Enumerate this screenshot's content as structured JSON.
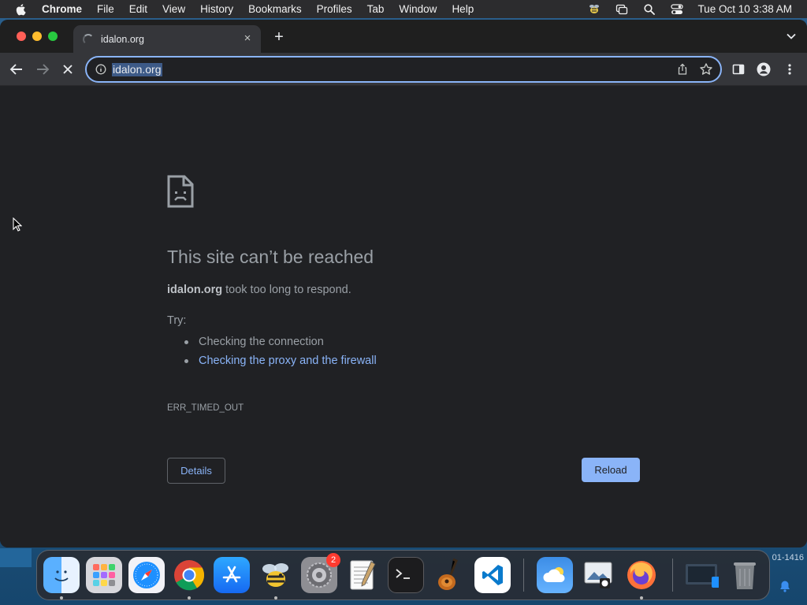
{
  "menubar": {
    "app_name": "Chrome",
    "items": [
      "File",
      "Edit",
      "View",
      "History",
      "Bookmarks",
      "Profiles",
      "Tab",
      "Window",
      "Help"
    ],
    "clock": "Tue Oct 10  3:38 AM"
  },
  "browser": {
    "tab_title": "idalon.org",
    "tab_close": "×",
    "new_tab": "+",
    "url": "idalon.org"
  },
  "error_page": {
    "title": "This site can’t be reached",
    "host": "idalon.org",
    "description_suffix": " took too long to respond.",
    "try_label": "Try:",
    "suggestions": [
      "Checking the connection",
      "Checking the proxy and the firewall"
    ],
    "error_code": "ERR_TIMED_OUT",
    "details_button": "Details",
    "reload_button": "Reload"
  },
  "desktop": {
    "corner_text": "01-1416"
  },
  "dock": {
    "apps": [
      "finder-icon",
      "launchpad-icon",
      "safari-icon",
      "chrome-icon",
      "app-store-icon",
      "bee-app-icon",
      "system-settings-icon",
      "textedit-icon",
      "terminal-icon",
      "garageband-icon",
      "vscode-icon",
      "weather-icon",
      "preview-icon",
      "firefox-icon",
      "screenshot-folder-icon",
      "trash-icon"
    ],
    "settings_badge": "2"
  }
}
